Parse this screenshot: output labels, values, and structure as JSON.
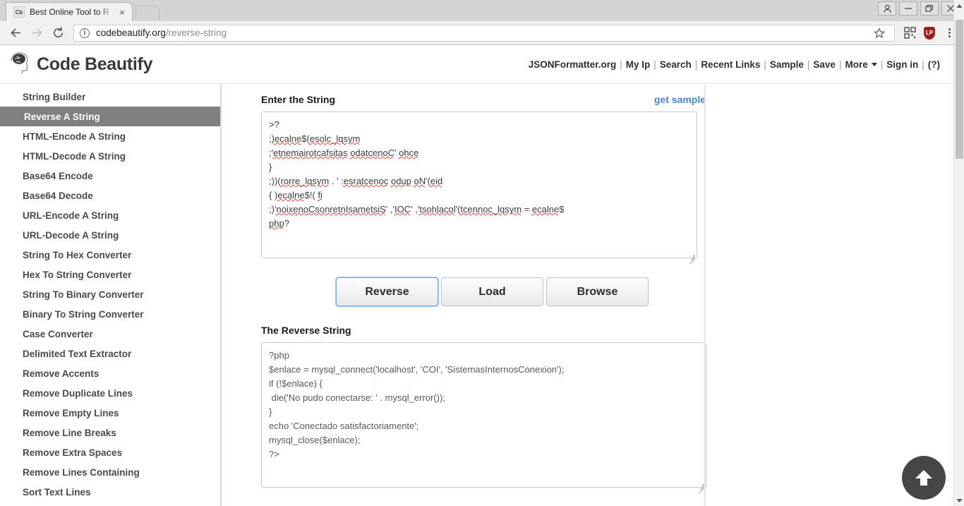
{
  "browser": {
    "tab": {
      "favicon_text": "Cb",
      "title": "Best Online Tool to R",
      "close_icon": "×"
    },
    "window_controls": {
      "profile": "👤",
      "minimize": "—",
      "maximize": "❐",
      "close": "✕"
    },
    "toolbar": {
      "back_icon": "←",
      "forward_icon": "→",
      "reload_icon": "⟳",
      "url_domain": "codebeautify.org",
      "url_path": "/reverse-string",
      "info_icon": "i",
      "bookmark_icon": "☆",
      "extension_qr": "▒",
      "extension_shield": "LP",
      "menu_icon": "kebab-menu"
    }
  },
  "site": {
    "brand_name": "Code Beautify",
    "logo_icon": "brain-head-logo",
    "nav": [
      {
        "label": "JSONFormatter.org",
        "sep": "|"
      },
      {
        "label": "My Ip",
        "sep": "|"
      },
      {
        "label": "Search",
        "sep": "|"
      },
      {
        "label": "Recent Links",
        "sep": "|"
      },
      {
        "label": "Sample",
        "sep": "|"
      },
      {
        "label": "Save",
        "sep": "|"
      },
      {
        "label": "More",
        "sep": "|",
        "caret": true
      },
      {
        "label": "Sign in",
        "sep": "|"
      },
      {
        "label": "(?)",
        "sep": ""
      }
    ]
  },
  "sidebar": {
    "items": [
      {
        "label": "String Builder",
        "active": false
      },
      {
        "label": "Reverse A String",
        "active": true
      },
      {
        "label": "HTML-Encode A String",
        "active": false
      },
      {
        "label": "HTML-Decode A String",
        "active": false
      },
      {
        "label": "Base64 Encode",
        "active": false
      },
      {
        "label": "Base64 Decode",
        "active": false
      },
      {
        "label": "URL-Encode A String",
        "active": false
      },
      {
        "label": "URL-Decode A String",
        "active": false
      },
      {
        "label": "String To Hex Converter",
        "active": false
      },
      {
        "label": "Hex To String Converter",
        "active": false
      },
      {
        "label": "String To Binary Converter",
        "active": false
      },
      {
        "label": "Binary To String Converter",
        "active": false
      },
      {
        "label": "Case Converter",
        "active": false
      },
      {
        "label": "Delimited Text Extractor",
        "active": false
      },
      {
        "label": "Remove Accents",
        "active": false
      },
      {
        "label": "Remove Duplicate Lines",
        "active": false
      },
      {
        "label": "Remove Empty Lines",
        "active": false
      },
      {
        "label": "Remove Line Breaks",
        "active": false
      },
      {
        "label": "Remove Extra Spaces",
        "active": false
      },
      {
        "label": "Remove Lines Containing",
        "active": false
      },
      {
        "label": "Sort Text Lines",
        "active": false
      }
    ]
  },
  "main": {
    "input_label": "Enter the String",
    "get_sample_label": "get sample",
    "input_value": ">?\n;)ecalne$(esolc_lqsym\n;'etnemairotcafsitas odatcenoC' ohce\n}\n;))(rorre_lqsym . ' :esratcenoc odup oN'(eid\n{ )ecalne$!( fi\n;)'noixenoCsonretnIsametsiS' ,'IOC' ,'tsohlacol'(tcennoc_lqsym = ecalne$\nphp?",
    "output_label": "The Reverse String",
    "output_value": "?php\n$enlace = mysql_connect('localhost', 'COI', 'SistemasInternosConexion');\nif (!$enlace) {\n die('No pudo conectarse: ' . mysql_error());\n}\necho 'Conectado satisfactoriamente';\nmysql_close($enlace);\n?>",
    "buttons": [
      {
        "label": "Reverse",
        "focused": true
      },
      {
        "label": "Load",
        "focused": false
      },
      {
        "label": "Browse",
        "focused": false
      }
    ],
    "scroll_top_icon": "arrow-up"
  },
  "colors": {
    "accent_link": "#4a86c7",
    "sidebar_active_bg": "#808080",
    "spellcheck_underline": "#e24b3c",
    "scroll_top_bg": "#464646"
  }
}
